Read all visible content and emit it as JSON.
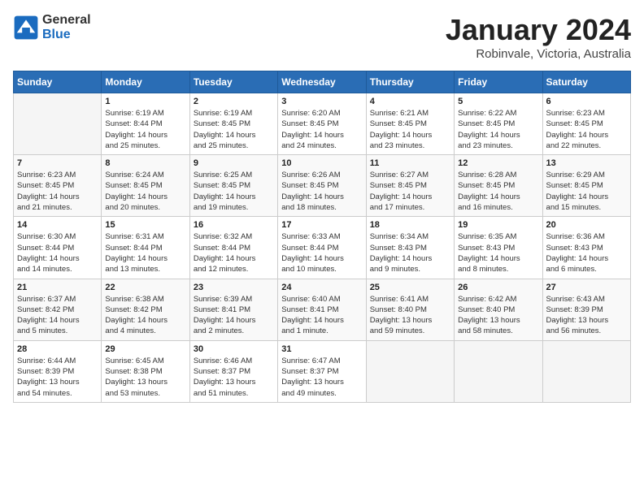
{
  "logo": {
    "line1": "General",
    "line2": "Blue"
  },
  "title": "January 2024",
  "subtitle": "Robinvale, Victoria, Australia",
  "headers": [
    "Sunday",
    "Monday",
    "Tuesday",
    "Wednesday",
    "Thursday",
    "Friday",
    "Saturday"
  ],
  "weeks": [
    [
      {
        "day": "",
        "info": ""
      },
      {
        "day": "1",
        "info": "Sunrise: 6:19 AM\nSunset: 8:44 PM\nDaylight: 14 hours\nand 25 minutes."
      },
      {
        "day": "2",
        "info": "Sunrise: 6:19 AM\nSunset: 8:45 PM\nDaylight: 14 hours\nand 25 minutes."
      },
      {
        "day": "3",
        "info": "Sunrise: 6:20 AM\nSunset: 8:45 PM\nDaylight: 14 hours\nand 24 minutes."
      },
      {
        "day": "4",
        "info": "Sunrise: 6:21 AM\nSunset: 8:45 PM\nDaylight: 14 hours\nand 23 minutes."
      },
      {
        "day": "5",
        "info": "Sunrise: 6:22 AM\nSunset: 8:45 PM\nDaylight: 14 hours\nand 23 minutes."
      },
      {
        "day": "6",
        "info": "Sunrise: 6:23 AM\nSunset: 8:45 PM\nDaylight: 14 hours\nand 22 minutes."
      }
    ],
    [
      {
        "day": "7",
        "info": "Sunrise: 6:23 AM\nSunset: 8:45 PM\nDaylight: 14 hours\nand 21 minutes."
      },
      {
        "day": "8",
        "info": "Sunrise: 6:24 AM\nSunset: 8:45 PM\nDaylight: 14 hours\nand 20 minutes."
      },
      {
        "day": "9",
        "info": "Sunrise: 6:25 AM\nSunset: 8:45 PM\nDaylight: 14 hours\nand 19 minutes."
      },
      {
        "day": "10",
        "info": "Sunrise: 6:26 AM\nSunset: 8:45 PM\nDaylight: 14 hours\nand 18 minutes."
      },
      {
        "day": "11",
        "info": "Sunrise: 6:27 AM\nSunset: 8:45 PM\nDaylight: 14 hours\nand 17 minutes."
      },
      {
        "day": "12",
        "info": "Sunrise: 6:28 AM\nSunset: 8:45 PM\nDaylight: 14 hours\nand 16 minutes."
      },
      {
        "day": "13",
        "info": "Sunrise: 6:29 AM\nSunset: 8:45 PM\nDaylight: 14 hours\nand 15 minutes."
      }
    ],
    [
      {
        "day": "14",
        "info": "Sunrise: 6:30 AM\nSunset: 8:44 PM\nDaylight: 14 hours\nand 14 minutes."
      },
      {
        "day": "15",
        "info": "Sunrise: 6:31 AM\nSunset: 8:44 PM\nDaylight: 14 hours\nand 13 minutes."
      },
      {
        "day": "16",
        "info": "Sunrise: 6:32 AM\nSunset: 8:44 PM\nDaylight: 14 hours\nand 12 minutes."
      },
      {
        "day": "17",
        "info": "Sunrise: 6:33 AM\nSunset: 8:44 PM\nDaylight: 14 hours\nand 10 minutes."
      },
      {
        "day": "18",
        "info": "Sunrise: 6:34 AM\nSunset: 8:43 PM\nDaylight: 14 hours\nand 9 minutes."
      },
      {
        "day": "19",
        "info": "Sunrise: 6:35 AM\nSunset: 8:43 PM\nDaylight: 14 hours\nand 8 minutes."
      },
      {
        "day": "20",
        "info": "Sunrise: 6:36 AM\nSunset: 8:43 PM\nDaylight: 14 hours\nand 6 minutes."
      }
    ],
    [
      {
        "day": "21",
        "info": "Sunrise: 6:37 AM\nSunset: 8:42 PM\nDaylight: 14 hours\nand 5 minutes."
      },
      {
        "day": "22",
        "info": "Sunrise: 6:38 AM\nSunset: 8:42 PM\nDaylight: 14 hours\nand 4 minutes."
      },
      {
        "day": "23",
        "info": "Sunrise: 6:39 AM\nSunset: 8:41 PM\nDaylight: 14 hours\nand 2 minutes."
      },
      {
        "day": "24",
        "info": "Sunrise: 6:40 AM\nSunset: 8:41 PM\nDaylight: 14 hours\nand 1 minute."
      },
      {
        "day": "25",
        "info": "Sunrise: 6:41 AM\nSunset: 8:40 PM\nDaylight: 13 hours\nand 59 minutes."
      },
      {
        "day": "26",
        "info": "Sunrise: 6:42 AM\nSunset: 8:40 PM\nDaylight: 13 hours\nand 58 minutes."
      },
      {
        "day": "27",
        "info": "Sunrise: 6:43 AM\nSunset: 8:39 PM\nDaylight: 13 hours\nand 56 minutes."
      }
    ],
    [
      {
        "day": "28",
        "info": "Sunrise: 6:44 AM\nSunset: 8:39 PM\nDaylight: 13 hours\nand 54 minutes."
      },
      {
        "day": "29",
        "info": "Sunrise: 6:45 AM\nSunset: 8:38 PM\nDaylight: 13 hours\nand 53 minutes."
      },
      {
        "day": "30",
        "info": "Sunrise: 6:46 AM\nSunset: 8:37 PM\nDaylight: 13 hours\nand 51 minutes."
      },
      {
        "day": "31",
        "info": "Sunrise: 6:47 AM\nSunset: 8:37 PM\nDaylight: 13 hours\nand 49 minutes."
      },
      {
        "day": "",
        "info": ""
      },
      {
        "day": "",
        "info": ""
      },
      {
        "day": "",
        "info": ""
      }
    ]
  ]
}
